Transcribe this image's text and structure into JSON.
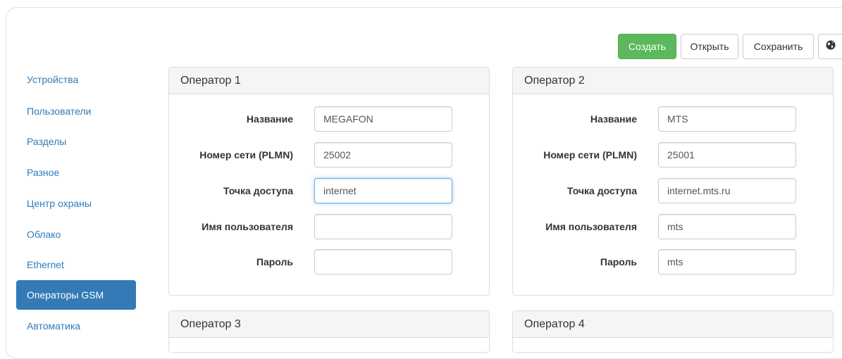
{
  "toolbar": {
    "create_label": "Создать",
    "open_label": "Открыть",
    "save_label": "Сохранить",
    "globe_icon": "globe-icon",
    "create_color": "#5cb85c"
  },
  "sidebar": {
    "items": [
      {
        "label": "Устройства",
        "active": false
      },
      {
        "label": "Пользователи",
        "active": false
      },
      {
        "label": "Разделы",
        "active": false
      },
      {
        "label": "Разное",
        "active": false
      },
      {
        "label": "Центр охраны",
        "active": false
      },
      {
        "label": "Облако",
        "active": false
      },
      {
        "label": "Ethernet",
        "active": false
      },
      {
        "label": "Операторы GSM",
        "active": true
      },
      {
        "label": "Автоматика",
        "active": false
      }
    ],
    "active_color": "#337ab7"
  },
  "labels": {
    "name": "Название",
    "plmn": "Номер сети (PLMN)",
    "apn": "Точка доступа",
    "username": "Имя пользователя",
    "password": "Пароль"
  },
  "operators": [
    {
      "title": "Оператор 1",
      "name": "MEGAFON",
      "plmn": "25002",
      "apn": "internet",
      "username": "",
      "password": ""
    },
    {
      "title": "Оператор 2",
      "name": "MTS",
      "plmn": "25001",
      "apn": "internet.mts.ru",
      "username": "mts",
      "password": "mts"
    },
    {
      "title": "Оператор 3"
    },
    {
      "title": "Оператор 4"
    }
  ]
}
